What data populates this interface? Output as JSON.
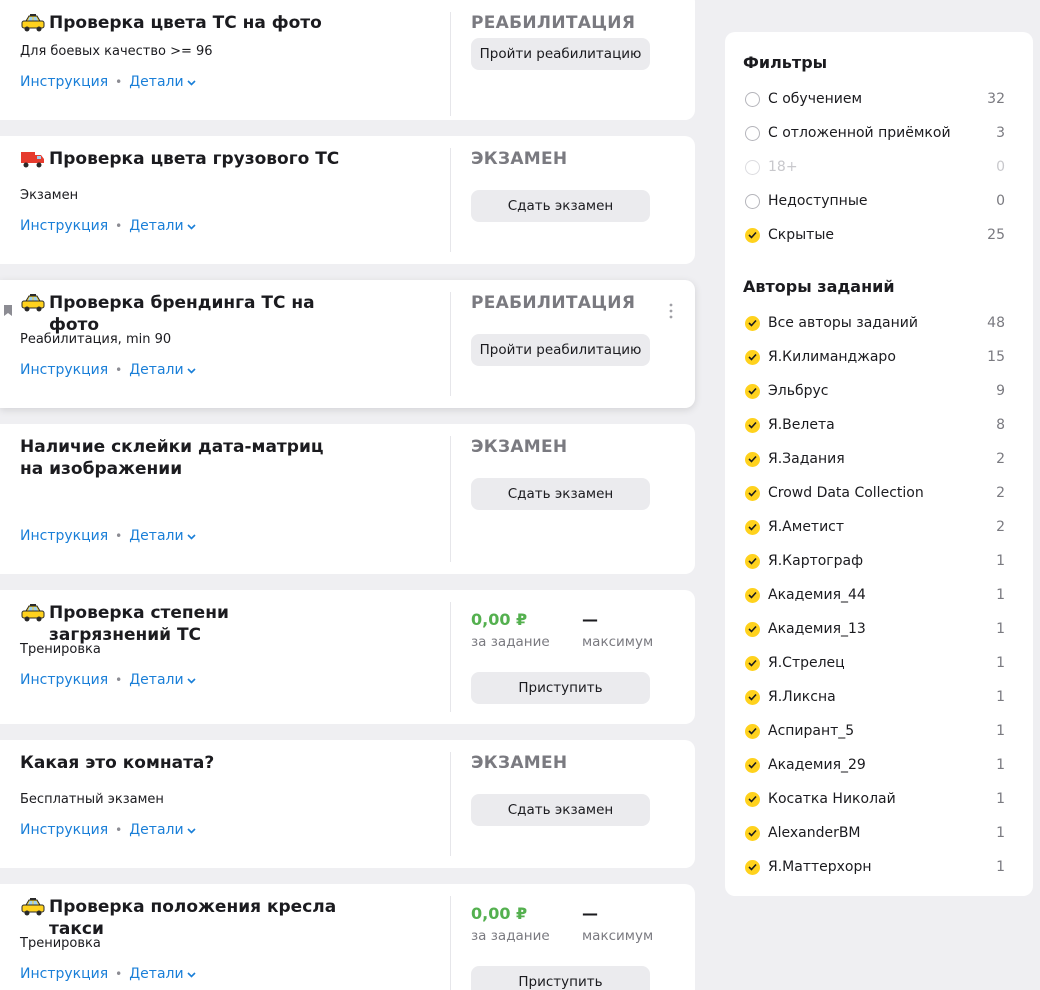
{
  "common": {
    "link_instruction": "Инструкция",
    "link_details": "Детали"
  },
  "tasks": [
    {
      "title": "Проверка цвета ТС на фото",
      "desc": "Для боевых качество >= 96",
      "status": "РЕАБИЛИТАЦИЯ",
      "action": "Пройти реабилитацию",
      "icon": "taxi-icon"
    },
    {
      "title": "Проверка цвета грузового ТС",
      "desc": "Экзамен",
      "status": "ЭКЗАМЕН",
      "action": "Сдать экзамен",
      "icon": "truck-icon"
    },
    {
      "title": "Проверка брендинга ТС на фото",
      "desc": "Реабилитация, min 90",
      "status": "РЕАБИЛИТАЦИЯ",
      "action": "Пройти реабилитацию",
      "icon": "taxi-icon"
    },
    {
      "title": "Наличие склейки дата-матриц на изображении",
      "desc": "",
      "status": "ЭКЗАМЕН",
      "action": "Сдать экзамен"
    },
    {
      "title": "Проверка степени загрязнений ТС",
      "desc": "Тренировка",
      "price": "0,00 ₽",
      "price_label": "за задание",
      "max": "—",
      "max_label": "максимум",
      "action": "Приступить",
      "icon": "taxi-icon"
    },
    {
      "title": "Какая это комната?",
      "desc": "Бесплатный экзамен",
      "status": "ЭКЗАМЕН",
      "action": "Сдать экзамен"
    },
    {
      "title": "Проверка положения кресла такси",
      "desc": "Тренировка",
      "price": "0,00 ₽",
      "price_label": "за задание",
      "max": "—",
      "max_label": "максимум",
      "action": "Приступить",
      "icon": "taxi-icon"
    }
  ],
  "filters": {
    "title": "Фильтры",
    "items": [
      {
        "label": "С обучением",
        "count": "32",
        "checked": false
      },
      {
        "label": "С отложенной приёмкой",
        "count": "3",
        "checked": false
      },
      {
        "label": "18+",
        "count": "0",
        "checked": false,
        "disabled": true
      },
      {
        "label": "Недоступные",
        "count": "0",
        "checked": false
      },
      {
        "label": "Скрытые",
        "count": "25",
        "checked": true
      }
    ]
  },
  "authors": {
    "title": "Авторы заданий",
    "items": [
      {
        "label": "Все авторы заданий",
        "count": "48"
      },
      {
        "label": "Я.Килиманджаро",
        "count": "15"
      },
      {
        "label": "Эльбрус",
        "count": "9"
      },
      {
        "label": "Я.Велета",
        "count": "8"
      },
      {
        "label": "Я.Задания",
        "count": "2"
      },
      {
        "label": "Crowd Data Collection",
        "count": "2"
      },
      {
        "label": "Я.Аметист",
        "count": "2"
      },
      {
        "label": "Я.Картограф",
        "count": "1"
      },
      {
        "label": "Академия_44",
        "count": "1"
      },
      {
        "label": "Академия_13",
        "count": "1"
      },
      {
        "label": "Я.Стрелец",
        "count": "1"
      },
      {
        "label": "Я.Ликсна",
        "count": "1"
      },
      {
        "label": "Аспирант_5",
        "count": "1"
      },
      {
        "label": "Академия_29",
        "count": "1"
      },
      {
        "label": "Косатка Николай",
        "count": "1"
      },
      {
        "label": "AlexanderBM",
        "count": "1"
      },
      {
        "label": "Я.Маттерхорн",
        "count": "1"
      }
    ]
  },
  "colors": {
    "accent": "#ffd21e",
    "link": "#1a7fd8",
    "price": "#54b04f",
    "page_bg": "#efeff2"
  }
}
